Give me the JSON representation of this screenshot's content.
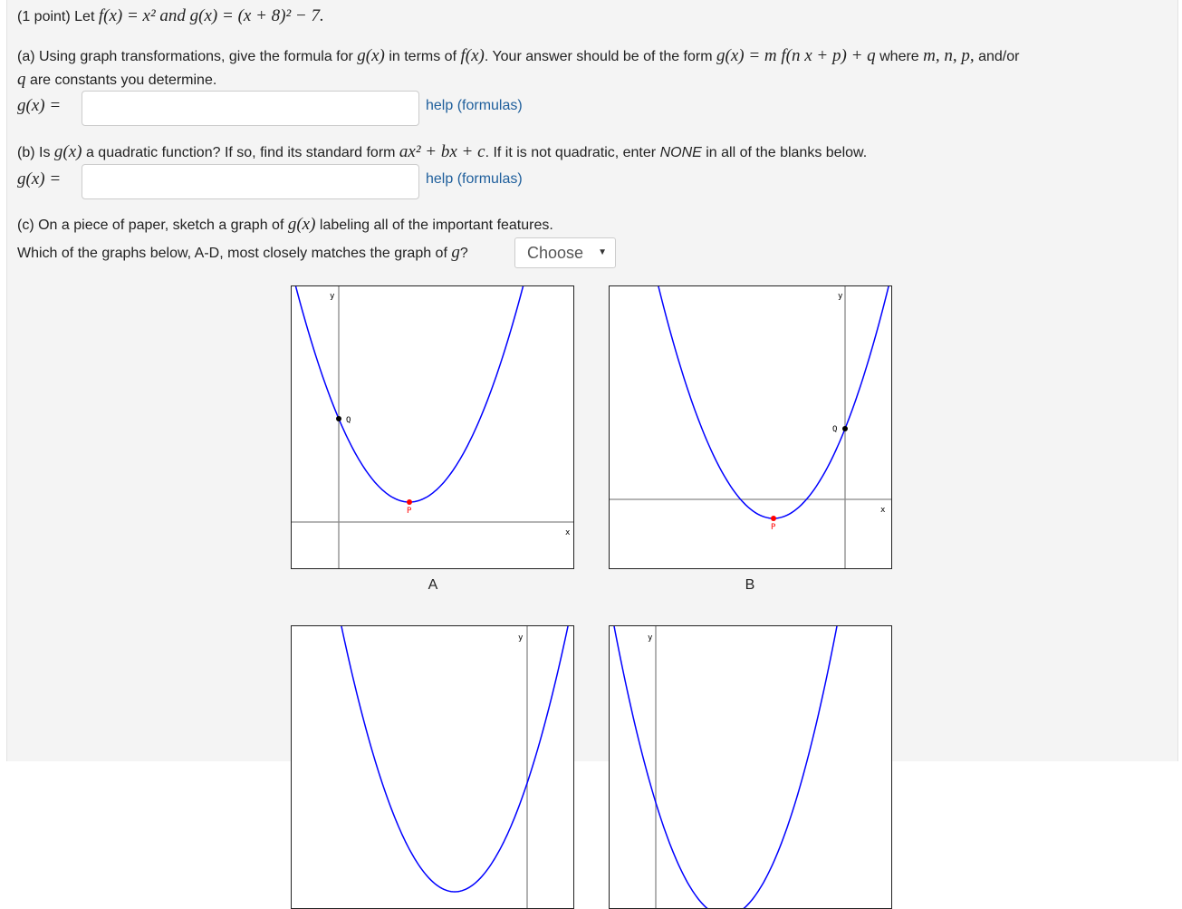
{
  "problem": {
    "intro_prefix": "(1 point) Let",
    "f_def": "f(x) = x² and g(x) = (x + 8)² − 7.",
    "and": "and"
  },
  "part_a": {
    "text1": "(a) Using graph transformations, give the formula for",
    "gx": "g(x)",
    "text2": "in terms of",
    "fx": "f(x)",
    "text3": ". Your answer should be of the form",
    "form": "g(x) = m f(n x + p) + q",
    "text4": "where",
    "vars": "m, n, p,",
    "text5": "and/or",
    "q": "q",
    "text6": "are constants you determine.",
    "input_label": "g(x) =",
    "input_value": "",
    "help": "help (formulas)"
  },
  "part_b": {
    "text1": "(b) Is",
    "gx": "g(x)",
    "text2": "a quadratic function? If so, find its standard form",
    "form": "ax² + bx + c",
    "text3": ". If it is not quadratic, enter",
    "none": "NONE",
    "text4": "in all of the blanks below.",
    "input_label": "g(x) =",
    "input_value": "",
    "help": "help (formulas)"
  },
  "part_c": {
    "text1": "(c) On a piece of paper, sketch a graph of",
    "gx": "g(x)",
    "text2": "labeling all of the important features.",
    "question": "Which of the graphs below, A-D, most closely matches the graph of",
    "g": "g",
    "qmark": "?",
    "select_value": "Choose"
  },
  "graphs": [
    {
      "label": "A",
      "x_label": "x",
      "y_label": "y",
      "vertex_label": "P",
      "intercept_label": "Q"
    },
    {
      "label": "B",
      "x_label": "x",
      "y_label": "y",
      "vertex_label": "P",
      "intercept_label": "Q"
    },
    {
      "label": "",
      "y_label": "y"
    },
    {
      "label": "",
      "y_label": "y"
    }
  ],
  "colors": {
    "curve": "#0000ff",
    "vertex": "#ff0000",
    "intercept": "#000000",
    "link": "#1f5f9c"
  }
}
